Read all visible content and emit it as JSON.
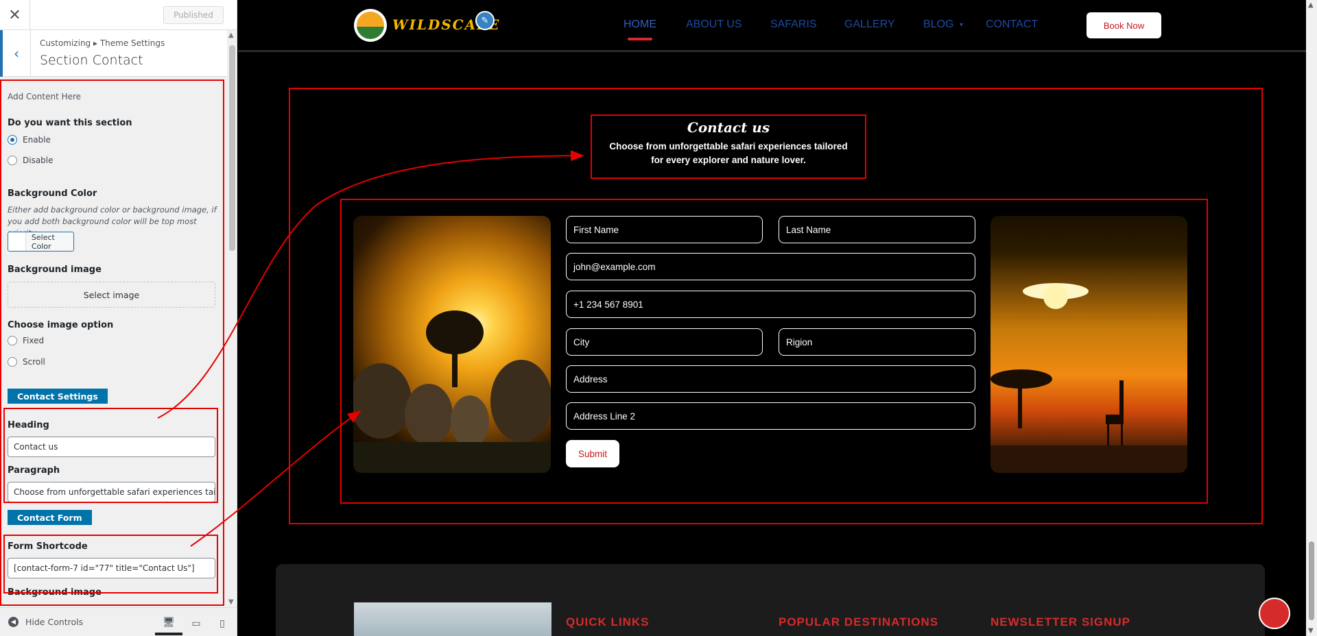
{
  "sidebar": {
    "close_icon": "close-icon",
    "published_label": "Published",
    "breadcrumb": "Customizing ▸ Theme Settings",
    "section_title": "Section Contact",
    "add_content": "Add Content Here",
    "section_question": "Do you want this section",
    "enable_label": "Enable",
    "disable_label": "Disable",
    "enabled": true,
    "bg_color_label": "Background Color",
    "bg_color_note": "Either add background color or background image, if you add both background color will be top most priority",
    "select_color_label": "Select Color",
    "bg_image_label": "Background image",
    "select_image_label": "Select image",
    "image_option_label": "Choose image option",
    "fixed_label": "Fixed",
    "scroll_label": "Scroll",
    "contact_settings_btn": "Contact Settings",
    "heading_label": "Heading",
    "heading_value": "Contact us",
    "paragraph_label": "Paragraph",
    "paragraph_value": "Choose from unforgettable safari experiences tailored for every explorer and nature lover.",
    "contact_form_btn": "Contact Form",
    "shortcode_label": "Form Shortcode",
    "shortcode_value": "[contact-form-7 id=\"77\" title=\"Contact Us\"]",
    "bg_image_label_2": "Background image",
    "hide_controls": "Hide Controls"
  },
  "site": {
    "logo_text": "WILDSCAPE",
    "nav": [
      "HOME",
      "ABOUT US",
      "SAFARIS",
      "GALLERY",
      "BLOG",
      "CONTACT"
    ],
    "active_nav": "HOME",
    "book_now": "Book Now",
    "contact_title": "Contact us",
    "contact_paragraph": "Choose from unforgettable safari experiences tailored for every explorer and nature lover.",
    "form": {
      "first_name": "First Name",
      "last_name": "Last Name",
      "email": "john@example.com",
      "phone": "+1 234 567 8901",
      "city": "City",
      "region": "Rigion",
      "address": "Address",
      "address2": "Address Line 2",
      "submit": "Submit"
    },
    "footer": {
      "quick_links": "QUICK LINKS",
      "popular_destinations": "POPULAR DESTINATIONS",
      "newsletter": "NEWSLETTER SIGNUP"
    }
  },
  "colors": {
    "accent_red": "#d62b2b",
    "wp_blue": "#2271b1",
    "button_blue": "#0073aa",
    "logo_gold": "#f5b800",
    "nav_blue": "#1e4aa0"
  }
}
